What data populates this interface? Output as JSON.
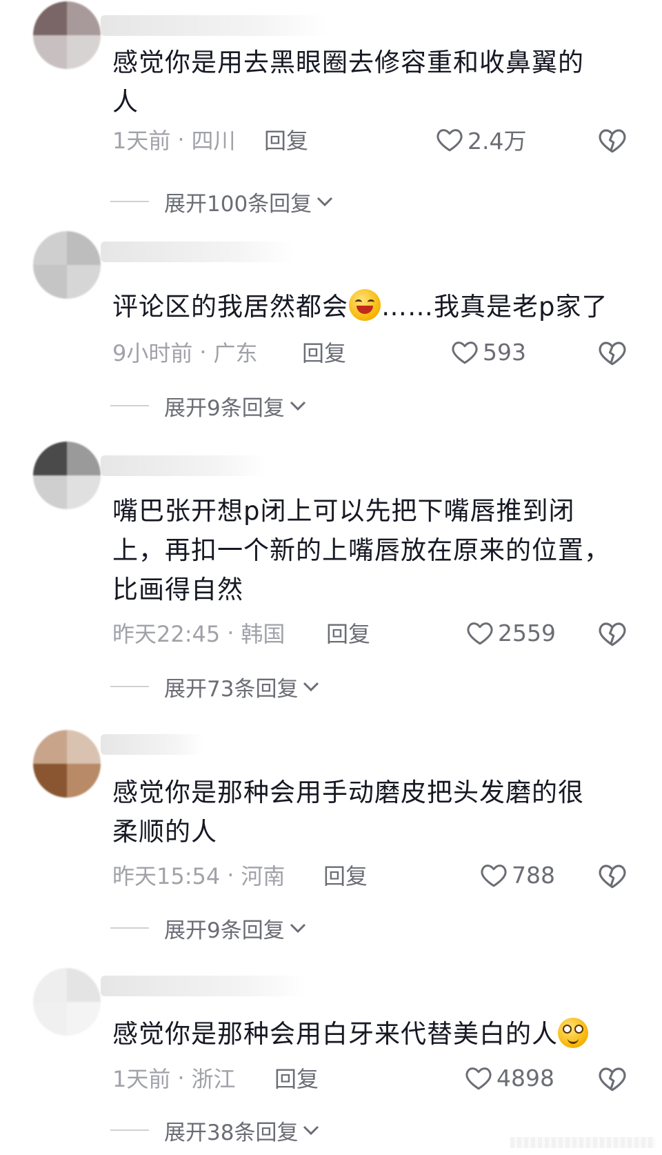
{
  "comments": [
    {
      "text": "感觉你是用去黑眼圈去修容重和收鼻翼的人",
      "time": "1天前",
      "location": "四川",
      "reply_label": "回复",
      "likes": "2.4万",
      "expand_label": "展开100条回复",
      "avatar_colors": [
        "#7a6666",
        "#a89a9a",
        "#c8c0c0",
        "#d8d3d3"
      ]
    },
    {
      "text_before_emoji": "评论区的我居然都会",
      "text_after_emoji": "……我真是老p家了",
      "emoji": "grinning-sweat-emoji",
      "time": "9小时前",
      "location": "广东",
      "reply_label": "回复",
      "likes": "593",
      "expand_label": "展开9条回复",
      "avatar_colors": [
        "#cfcfcf",
        "#bdbdbd",
        "#c5c5c5",
        "#d6d6d6"
      ]
    },
    {
      "text": "嘴巴张开想p闭上可以先把下嘴唇推到闭上，再扣一个新的上嘴唇放在原来的位置，比画得自然",
      "time": "昨天22:45",
      "location": "韩国",
      "reply_label": "回复",
      "likes": "2559",
      "expand_label": "展开73条回复",
      "avatar_colors": [
        "#4a4a4a",
        "#9a9a9a",
        "#cfcfcf",
        "#e0e0e0"
      ]
    },
    {
      "text": "感觉你是那种会用手动磨皮把头发磨的很柔顺的人",
      "time": "昨天15:54",
      "location": "河南",
      "reply_label": "回复",
      "likes": "788",
      "expand_label": "展开9条回复",
      "avatar_colors": [
        "#c8a48a",
        "#d9c2b0",
        "#8a5632",
        "#b88a66"
      ]
    },
    {
      "text": "感觉你是那种会用白牙来代替美白的人",
      "emoji": "woozy-face-emoji",
      "time": "1天前",
      "location": "浙江",
      "reply_label": "回复",
      "likes": "4898",
      "expand_label": "展开38条回复",
      "avatar_colors": [
        "#eeeeee",
        "#e4e4e4",
        "#f0f0f0",
        "#f4f4f4"
      ]
    }
  ],
  "icons": {
    "like": "heart-outline-icon",
    "dislike": "broken-heart-icon",
    "expand": "chevron-down-icon"
  },
  "colors": {
    "text": "#161823",
    "meta": "#a0a2a8",
    "secondary": "#6b6d75"
  }
}
